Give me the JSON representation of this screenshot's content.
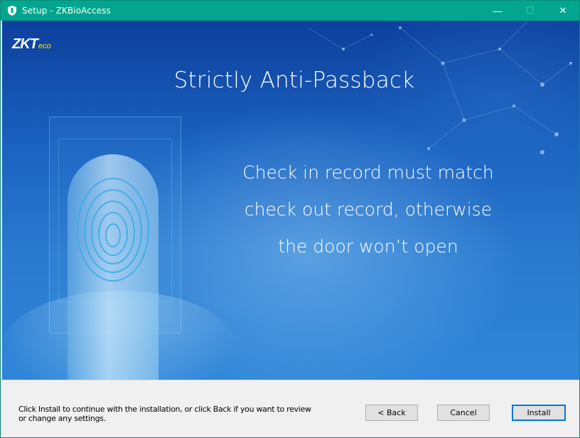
{
  "window": {
    "title": "Setup - ZKBioAccess",
    "accent_color": "#00a78e",
    "controls": {
      "minimize": "—",
      "maximize": "☐",
      "close": "✕"
    }
  },
  "banner": {
    "logo_main": "ZKT",
    "logo_sub": "eco",
    "headline": "Strictly Anti-Passback",
    "body_lines": [
      "Check in record must match",
      "check out record, otherwise",
      "the door won’t open"
    ]
  },
  "footer": {
    "message": "Click Install to continue with the installation, or click Back if you want to review or change any settings.",
    "back_label": "< Back",
    "cancel_label": "Cancel",
    "install_label": "Install"
  }
}
